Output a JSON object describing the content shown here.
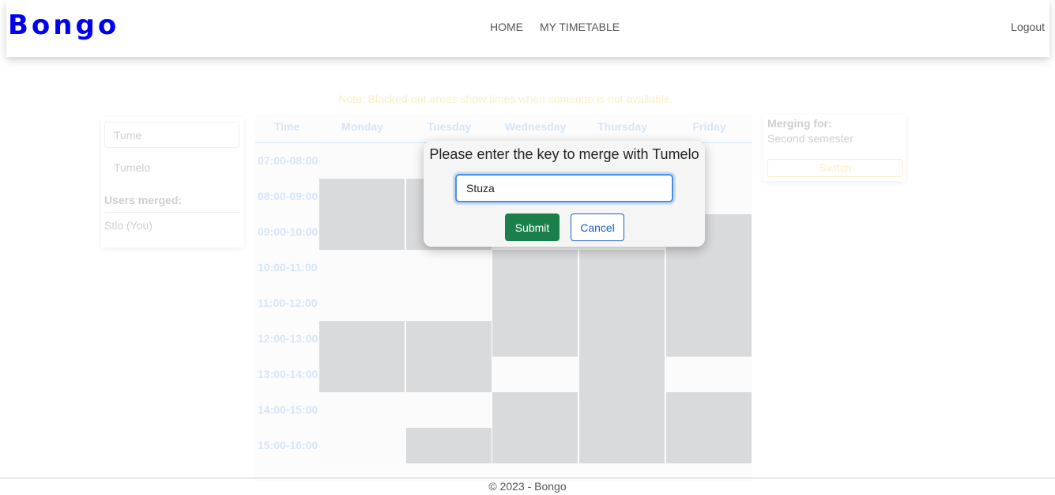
{
  "navbar": {
    "brand": "Bongo",
    "links": [
      "HOME",
      "MY TIMETABLE"
    ],
    "logout": "Logout"
  },
  "note": "Note: Blacked-out areas show times when someone is not available.",
  "left_panel": {
    "search_value": "Tume",
    "results": [
      "Tumelo"
    ],
    "users_heading": "Users merged:",
    "users": [
      "Stlo (You)"
    ]
  },
  "timetable": {
    "headers": [
      "Time",
      "Monday",
      "Tuesday",
      "Wednesday",
      "Thursday",
      "Friday"
    ],
    "times": [
      "07:00-08:00",
      "08:00-09:00",
      "09:00-10:00",
      "10:00-11:00",
      "11:00-12:00",
      "12:00-13:00",
      "13:00-14:00",
      "14:00-15:00",
      "15:00-16:00"
    ],
    "unavailable": {
      "Monday": [
        1,
        2,
        5,
        6
      ],
      "Tuesday": [
        1,
        2,
        5,
        6,
        8
      ],
      "Wednesday": [
        3,
        4,
        5,
        7,
        8
      ],
      "Thursday": [
        3,
        4,
        5,
        6,
        7,
        8
      ],
      "Friday": [
        2,
        3,
        4,
        5,
        7,
        8
      ]
    }
  },
  "right_panel": {
    "heading": "Merging for:",
    "semester": "Second semester",
    "switch_label": "Switch"
  },
  "modal": {
    "title": "Please enter the key to merge with Tumelo",
    "input_value": "Stuza",
    "submit_label": "Submit",
    "cancel_label": "Cancel"
  },
  "footer": "© 2023 - Bongo"
}
